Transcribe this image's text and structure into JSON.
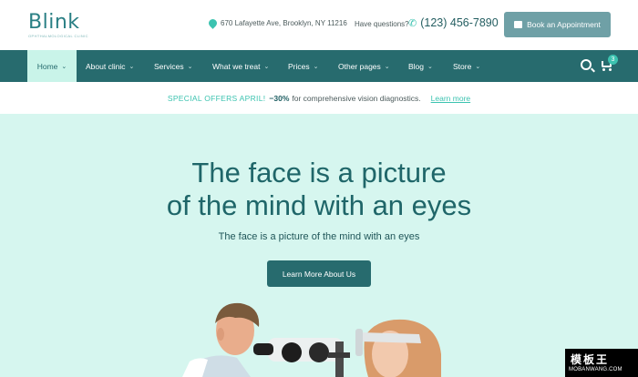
{
  "header": {
    "logo_name": "Blink",
    "logo_tagline": "OPHTHALMOLOGICAL CLINIC",
    "address": "670 Lafayette Ave, Brooklyn, NY 11216",
    "questions_label": "Have questions?",
    "phone": "(123) 456-7890",
    "book_button": "Book an Appointment"
  },
  "nav": {
    "items": [
      {
        "label": "Home"
      },
      {
        "label": "About clinic"
      },
      {
        "label": "Services"
      },
      {
        "label": "What we treat"
      },
      {
        "label": "Prices"
      },
      {
        "label": "Other pages"
      },
      {
        "label": "Blog"
      },
      {
        "label": "Store"
      }
    ],
    "cart_count": "3"
  },
  "offer": {
    "highlight": "SPECIAL OFFERS APRIL!",
    "percent": "−30%",
    "text": "for comprehensive vision diagnostics.",
    "link": "Learn more"
  },
  "hero": {
    "title_line1": "The face is a picture",
    "title_line2": "of the mind with an eyes",
    "subtitle": "The face is a picture of the mind with an eyes",
    "button": "Learn More About Us"
  },
  "watermark": {
    "top": "模板王",
    "bottom": "MOBANWANG.COM"
  },
  "colors": {
    "brand": "#276b6e",
    "accent": "#3cc3b0",
    "hero_bg": "#d6f6ef",
    "active_nav": "#c9f4e9",
    "book_button": "#6fa0a6"
  }
}
